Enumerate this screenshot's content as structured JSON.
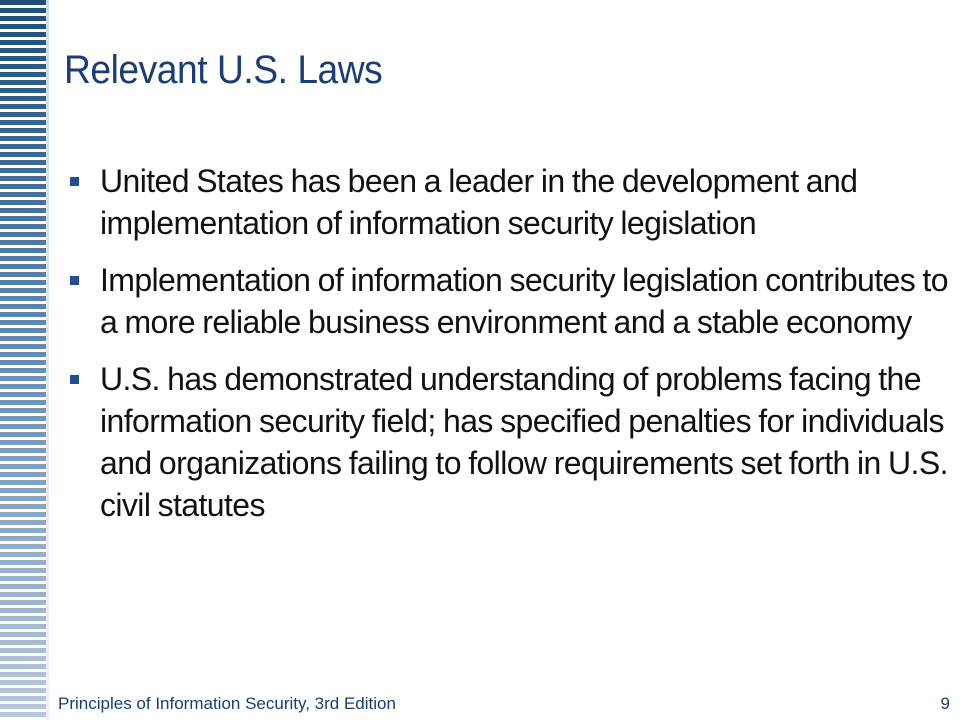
{
  "slide": {
    "title": "Relevant U.S. Laws",
    "bullets": [
      "United States has been a leader in the development and implementation of information security legislation",
      "Implementation of information security legislation contributes to a more reliable business environment and a stable economy",
      "U.S. has demonstrated understanding of problems facing the information security field; has specified penalties for individuals and organizations failing to follow requirements set forth in U.S. civil statutes"
    ]
  },
  "footer": {
    "book_title": "Principles of Information Security, 3rd Edition",
    "page_number": "9"
  },
  "colors": {
    "title": "#1a3d73",
    "bullet_marker": "#1f4f96",
    "stripe_dark": "#1f4e79",
    "stripe_light": "#b9c9dc"
  }
}
